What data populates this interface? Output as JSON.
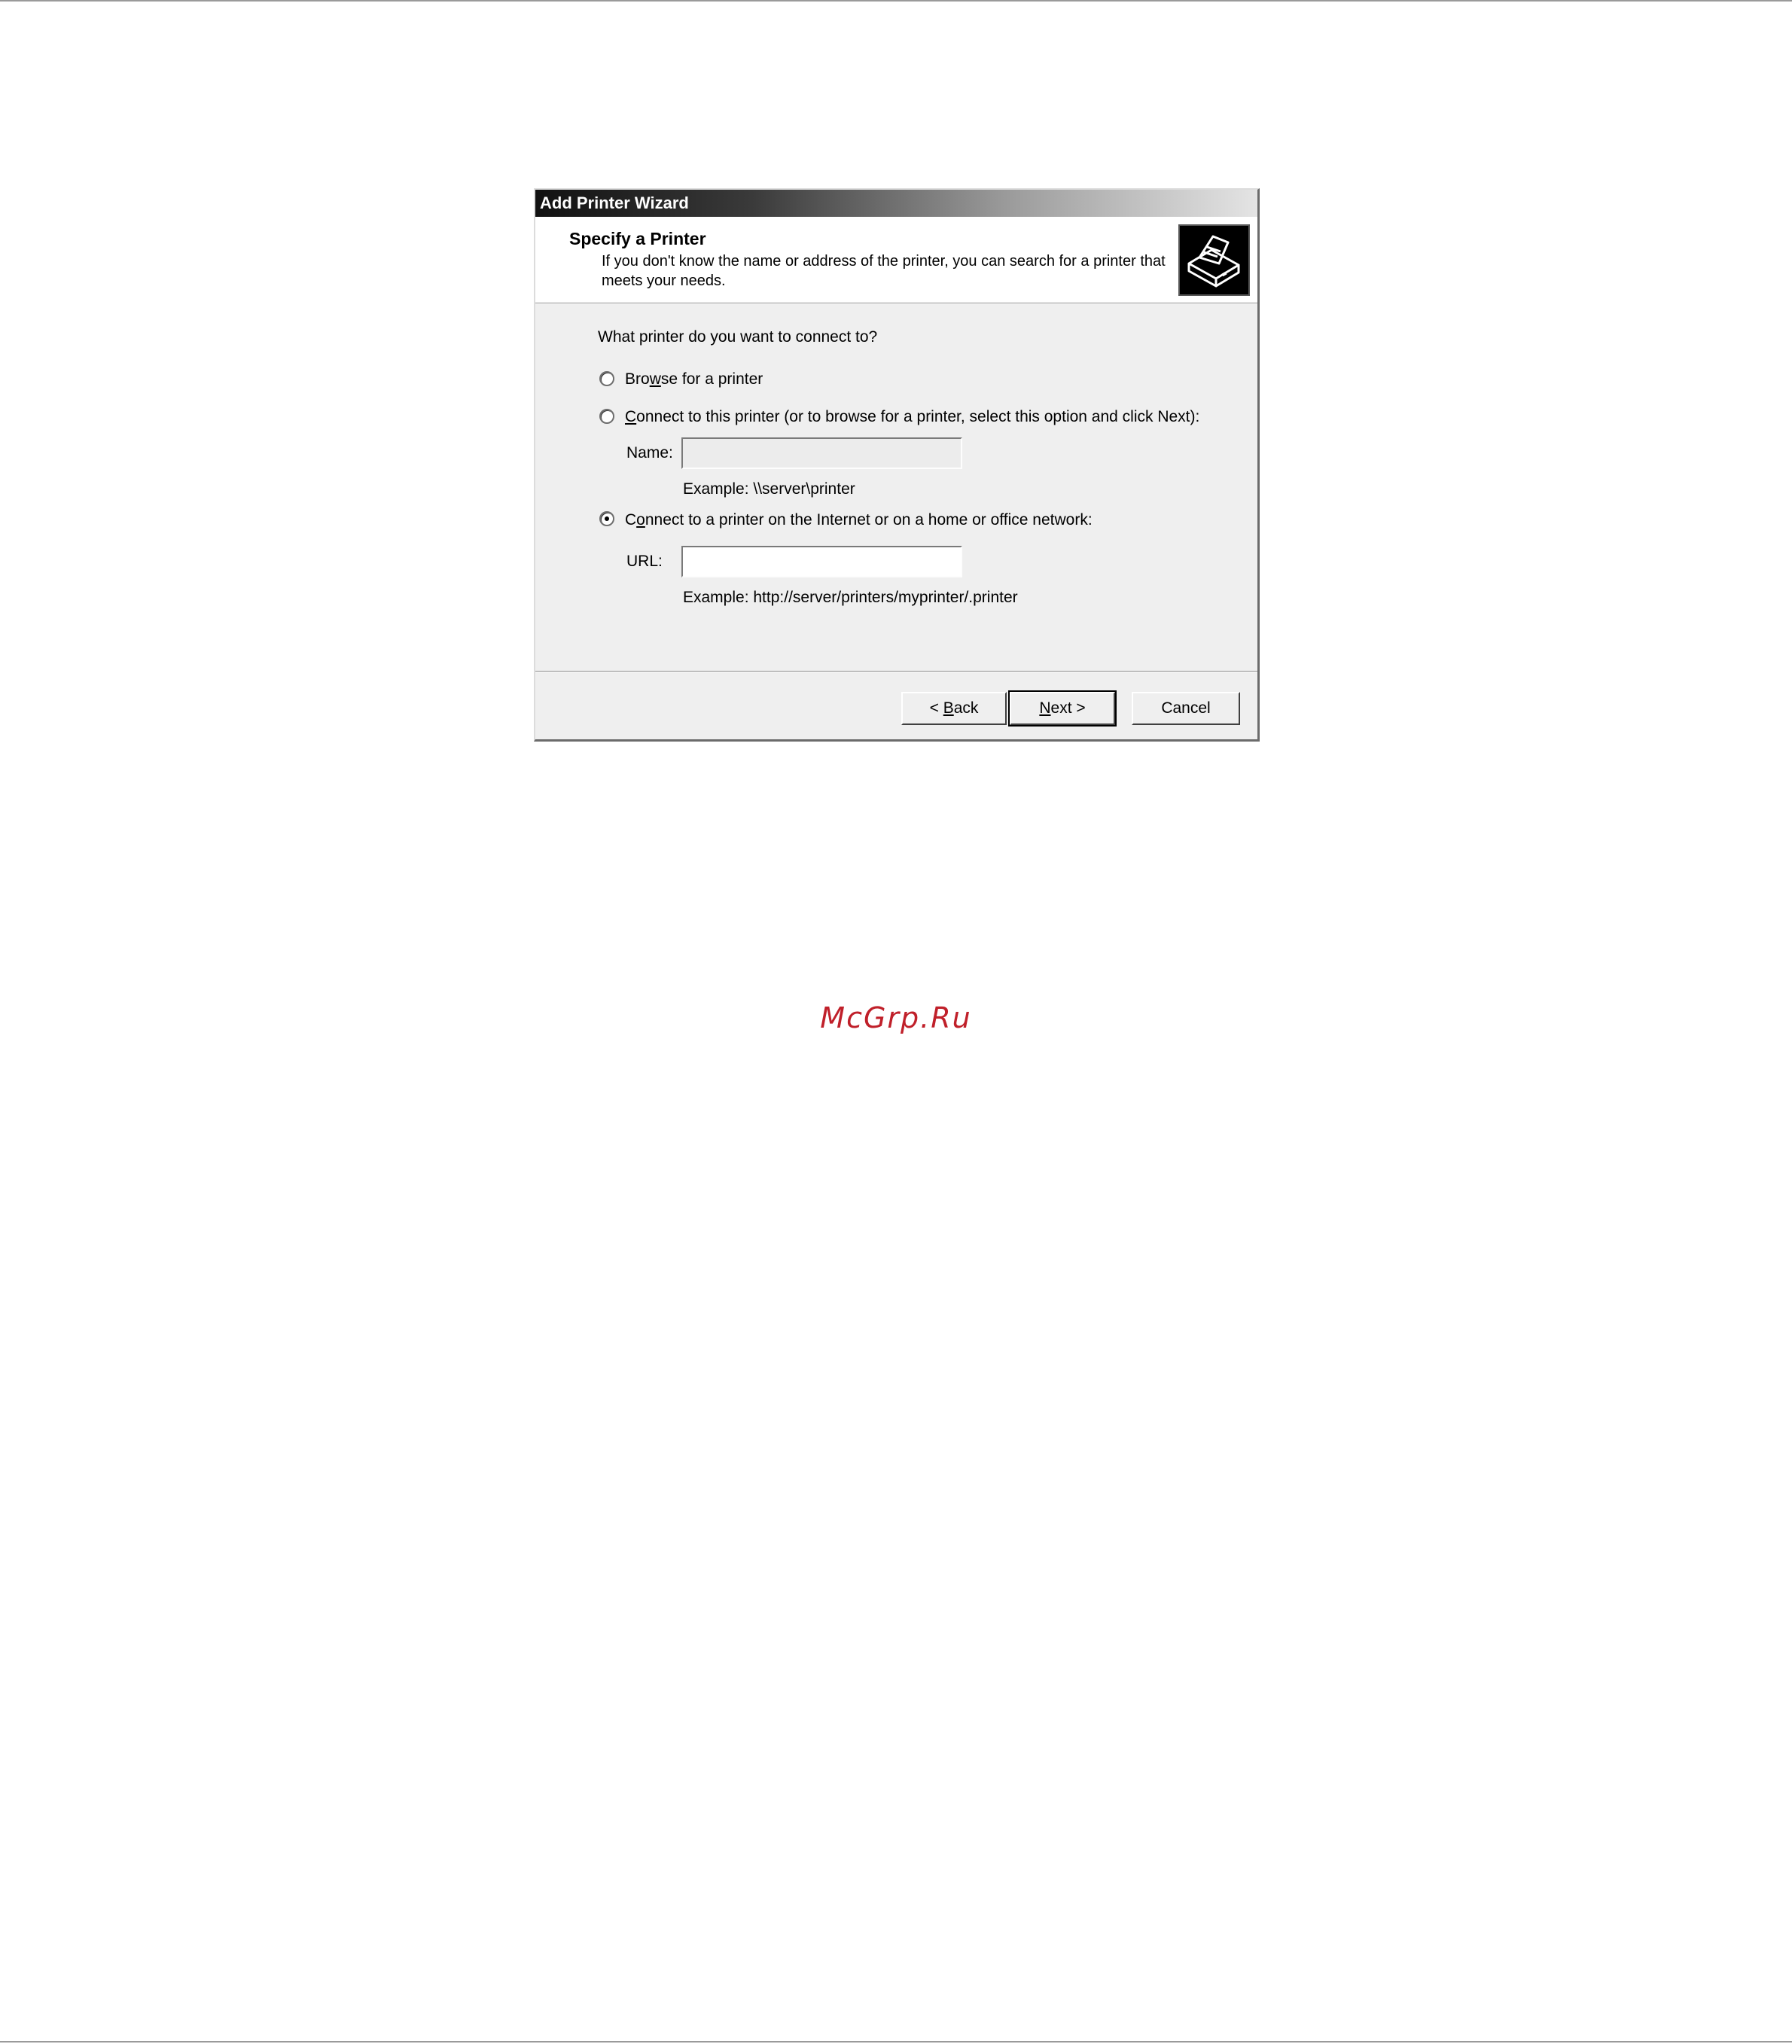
{
  "dialog": {
    "title": "Add Printer Wizard",
    "header_title": "Specify a Printer",
    "header_subtitle": "If you don't know the name or address of the printer, you can search for a printer that meets your needs.",
    "header_icon": "printer-icon"
  },
  "question": "What printer do you want to connect to?",
  "options": {
    "browse": {
      "pre": "Bro",
      "key": "w",
      "post": "se for a printer",
      "checked": false
    },
    "connect_name": {
      "pre": "",
      "key": "C",
      "post": "onnect to this printer (or to browse for a printer, select this option and click Next):",
      "checked": false
    },
    "connect_url": {
      "pre": "C",
      "key": "o",
      "post": "nnect to a printer on the Internet or on a home or office network:",
      "checked": true
    }
  },
  "name_field": {
    "label": "Name:",
    "value": "",
    "example": "Example: \\\\server\\printer"
  },
  "url_field": {
    "label": "URL:",
    "value": "",
    "example": "Example: http://server/printers/myprinter/.printer"
  },
  "buttons": {
    "back": {
      "pre": "< ",
      "key": "B",
      "post": "ack"
    },
    "next": {
      "pre": "",
      "key": "N",
      "post": "ext >"
    },
    "cancel": "Cancel"
  },
  "watermark": "McGrp.Ru"
}
